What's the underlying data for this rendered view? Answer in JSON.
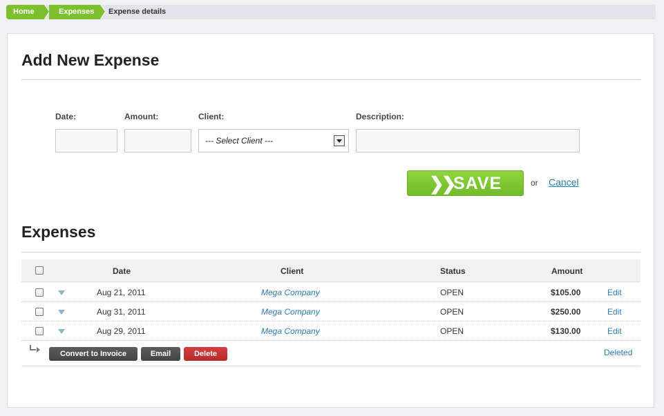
{
  "breadcrumb": {
    "home": "Home",
    "expenses": "Expenses",
    "current": "Expense details"
  },
  "add_form": {
    "title": "Add New Expense",
    "date_label": "Date:",
    "amount_label": "Amount:",
    "client_label": "Client:",
    "description_label": "Description:",
    "date_value": "",
    "amount_value": "",
    "client_selected": "--- Select Client ---",
    "description_value": "",
    "save_label": "SAVE",
    "save_icon": "double-chevron-right-icon",
    "or_text": "or",
    "cancel_label": "Cancel"
  },
  "expenses": {
    "title": "Expenses",
    "columns": [
      "Date",
      "Client",
      "Status",
      "Amount"
    ],
    "rows": [
      {
        "date": "Aug 21, 2011",
        "client": "Mega Company",
        "status": "OPEN",
        "amount": "$105.00",
        "action": "Edit"
      },
      {
        "date": "Aug 31, 2011",
        "client": "Mega Company",
        "status": "OPEN",
        "amount": "$250.00",
        "action": "Edit"
      },
      {
        "date": "Aug 29, 2011",
        "client": "Mega Company",
        "status": "OPEN",
        "amount": "$130.00",
        "action": "Edit"
      }
    ],
    "bulk_actions": {
      "convert": "Convert to Invoice",
      "email": "Email",
      "delete": "Delete"
    },
    "deleted_link": "Deleted"
  },
  "colors": {
    "accent_green": "#7cbf2f",
    "link_blue": "#2a7ab3",
    "danger_red": "#c43434"
  }
}
